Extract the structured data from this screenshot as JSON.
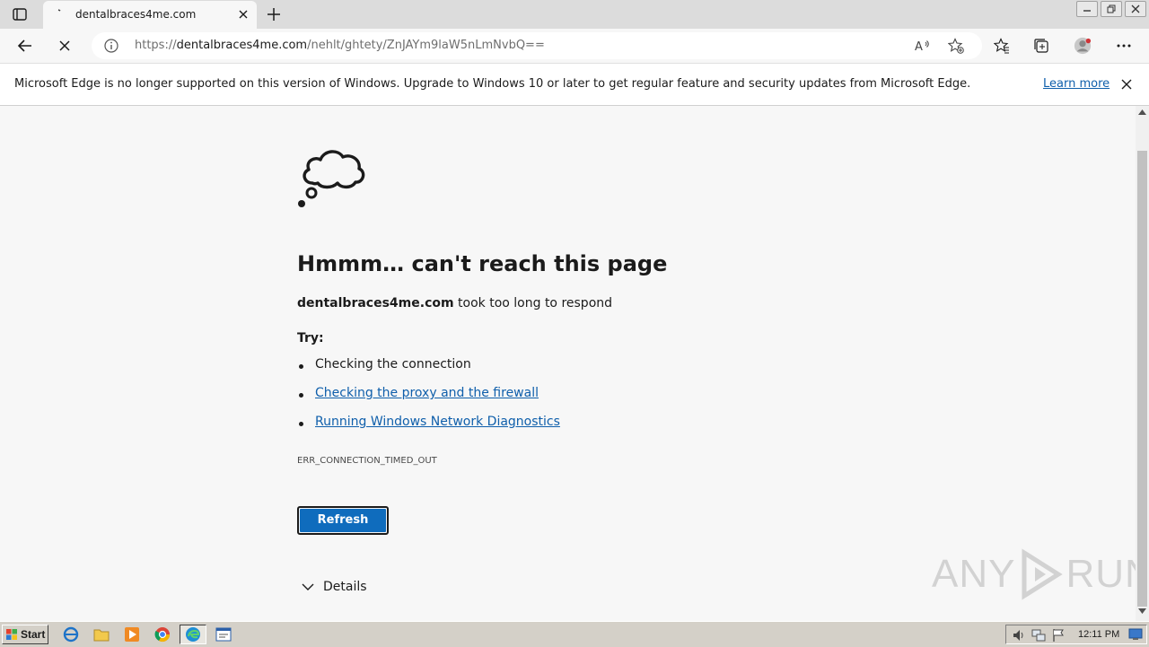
{
  "browser": {
    "tab_title": "dentalbraces4me.com",
    "url_prefix": "https://",
    "url_host": "dentalbraces4me.com",
    "url_path": "/nehlt/ghtety/ZnJAYm9laW5nLmNvbQ=="
  },
  "infobar": {
    "message": "Microsoft Edge is no longer supported on this version of Windows. Upgrade to Windows 10 or later to get regular feature and security updates from Microsoft Edge.",
    "learn_more": "Learn more"
  },
  "error_page": {
    "heading": "Hmmm… can't reach this page",
    "domain": "dentalbraces4me.com",
    "subtitle_suffix": " took too long to respond",
    "try_label": "Try:",
    "suggestions": [
      {
        "text": "Checking the connection",
        "is_link": false
      },
      {
        "text": "Checking the proxy and the firewall",
        "is_link": true
      },
      {
        "text": "Running Windows Network Diagnostics",
        "is_link": true
      }
    ],
    "error_code": "ERR_CONNECTION_TIMED_OUT",
    "refresh_button": "Refresh",
    "details_label": "Details"
  },
  "watermark": {
    "left": "ANY",
    "right": "RUN"
  },
  "taskbar": {
    "start_label": "Start",
    "clock": "12:11 PM"
  },
  "colors": {
    "accent_blue": "#0f6cbd",
    "link_blue": "#0f5fab"
  }
}
